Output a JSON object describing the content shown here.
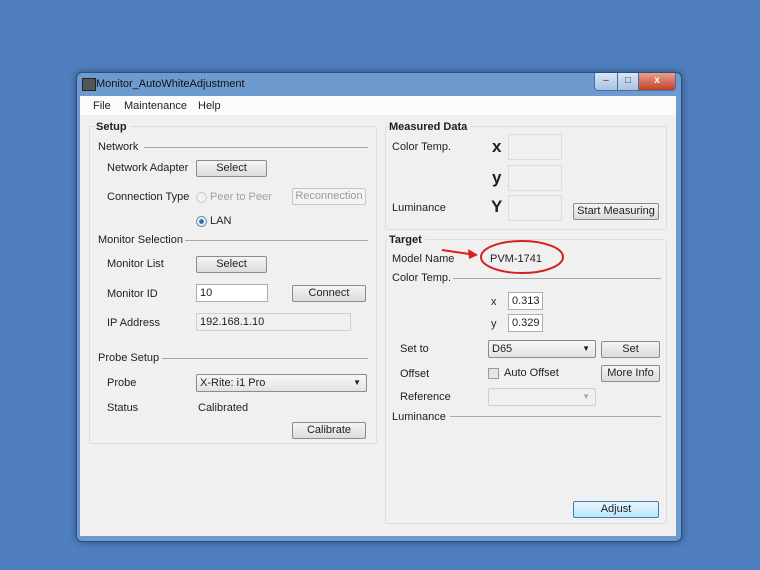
{
  "window": {
    "title": "Monitor_AutoWhiteAdjustment",
    "minimize": "–",
    "maximize": "□",
    "close": "x"
  },
  "menu": [
    "File",
    "Maintenance",
    "Help"
  ],
  "setup": {
    "title": "Setup",
    "network": {
      "title": "Network",
      "adapter_label": "Network Adapter",
      "adapter_button": "Select",
      "conn_label": "Connection Type",
      "peer": "Peer to Peer",
      "reconnect": "Reconnection",
      "lan": "LAN",
      "selected": "LAN"
    },
    "monitor": {
      "title": "Monitor Selection",
      "list_label": "Monitor List",
      "list_button": "Select",
      "id_label": "Monitor ID",
      "id_value": "10",
      "connect": "Connect",
      "ip_label": "IP Address",
      "ip_value": "192.168.1.10"
    },
    "probe": {
      "title": "Probe Setup",
      "probe_label": "Probe",
      "probe_value": "X-Rite: i1 Pro",
      "status_label": "Status",
      "status_value": "Calibrated",
      "calibrate": "Calibrate"
    }
  },
  "measured": {
    "title": "Measured Data",
    "color_temp": "Color Temp.",
    "x": "x",
    "y": "y",
    "Y": "Y",
    "luminance": "Luminance",
    "start": "Start Measuring"
  },
  "target": {
    "title": "Target",
    "model_label": "Model Name",
    "model_value": "PVM-1741",
    "color_temp": "Color Temp.",
    "x_label": "x",
    "x_value": "0.313",
    "y_label": "y",
    "y_value": "0.329",
    "setto_label": "Set to",
    "setto_value": "D65",
    "set": "Set",
    "offset_label": "Offset",
    "auto_offset": "Auto Offset",
    "auto_offset_checked": false,
    "more_info": "More Info",
    "reference_label": "Reference",
    "reference_value": "",
    "luminance": "Luminance",
    "adjust": "Adjust"
  },
  "annotation_color": "#d62020"
}
